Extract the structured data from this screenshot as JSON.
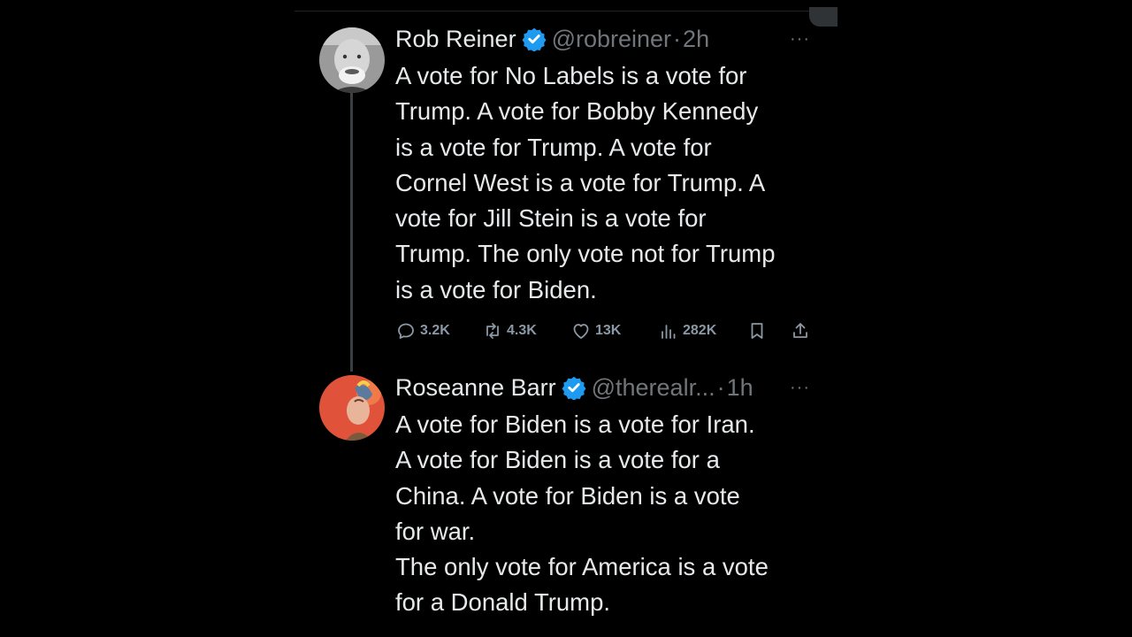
{
  "tweets": [
    {
      "display_name": "Rob Reiner",
      "handle": "@robreiner",
      "separator": "·",
      "time": "2h",
      "more": "···",
      "body_lines": [
        "A vote for No Labels is a vote for",
        "Trump. A vote for Bobby Kennedy",
        "is a vote for Trump. A vote for",
        "Cornel West is a vote for Trump. A",
        "vote for Jill Stein is a vote for",
        "Trump. The only vote not for Trump",
        "is a vote for Biden."
      ],
      "actions": {
        "replies": "3.2K",
        "reposts": "4.3K",
        "likes": "13K",
        "views": "282K"
      }
    },
    {
      "display_name": "Roseanne Barr",
      "handle": "@therealr...",
      "separator": "·",
      "time": "1h",
      "more": "···",
      "body_lines": [
        "A vote for Biden is a vote for Iran.",
        "A vote for Biden is a vote for a",
        "China. A vote for Biden is a vote",
        "for war.",
        "The only vote for America is a vote",
        "for a Donald Trump."
      ]
    }
  ],
  "colors": {
    "background": "#000000",
    "text": "#e7e9ea",
    "secondary_text": "#71767b",
    "verified_badge": "#1d9bf0",
    "thread_line": "#3a3f44"
  },
  "icons": {
    "reply": "reply-icon",
    "repost": "repost-icon",
    "like": "heart-icon",
    "views": "views-icon",
    "bookmark": "bookmark-icon",
    "share": "share-icon",
    "verified": "verified-badge-icon"
  }
}
